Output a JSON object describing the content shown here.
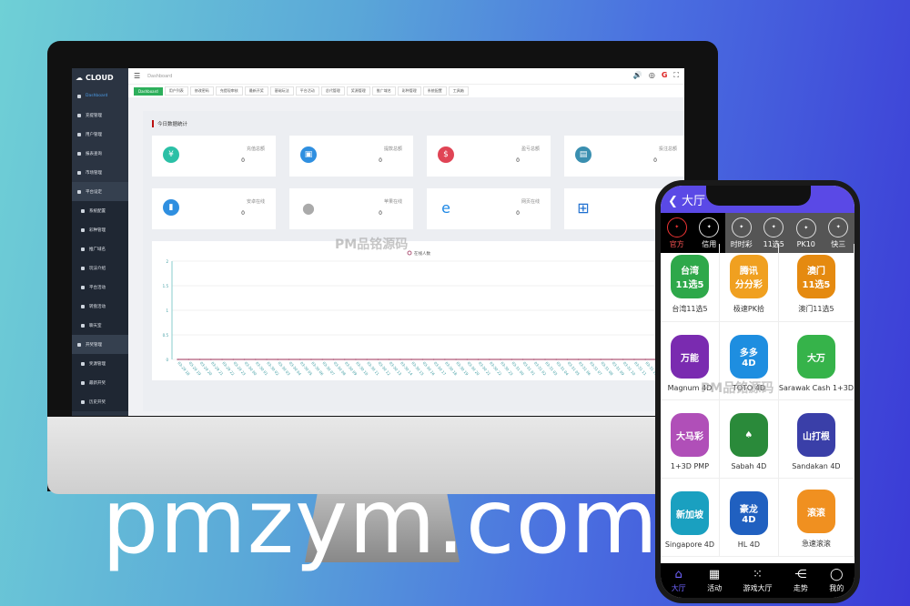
{
  "admin": {
    "logo": "CLOUD",
    "breadcrumb": "Dashboard",
    "sidebar": [
      {
        "label": "Dashboard",
        "active": true
      },
      {
        "label": "充提管理"
      },
      {
        "label": "用户管理"
      },
      {
        "label": "报表查询"
      },
      {
        "label": "市场管理"
      },
      {
        "label": "平台设定",
        "open": true
      },
      {
        "label": "系统配置",
        "sub": true
      },
      {
        "label": "彩种管理",
        "sub": true
      },
      {
        "label": "推广域名",
        "sub": true
      },
      {
        "label": "玩法介绍",
        "sub": true
      },
      {
        "label": "平台活动",
        "sub": true
      },
      {
        "label": "转盘活动",
        "sub": true
      },
      {
        "label": "聊天室",
        "sub": true
      },
      {
        "label": "开奖管理",
        "open": true
      },
      {
        "label": "奖源管理",
        "sub": true
      },
      {
        "label": "最新开奖",
        "sub": true
      },
      {
        "label": "历史开奖",
        "sub": true
      }
    ],
    "tabs": [
      "Dashboard",
      "用户列表",
      "修改密码",
      "充提现审核",
      "最新开奖",
      "基础玩法",
      "平台活动",
      "总代管理",
      "奖源管理",
      "推广域名",
      "彩种管理",
      "系统配置",
      "工具箱"
    ],
    "section_title": "今日数据统计",
    "cards": [
      {
        "label": "充值总额",
        "value": "0",
        "icon": "yen-icon",
        "color": "#2bc0a6"
      },
      {
        "label": "提款总额",
        "value": "0",
        "icon": "wallet-icon",
        "color": "#2f8fe0"
      },
      {
        "label": "盈亏总额",
        "value": "0",
        "icon": "coins-icon",
        "color": "#e04455"
      },
      {
        "label": "投注总额",
        "value": "0",
        "icon": "receipt-icon",
        "color": "#3a8fb0"
      },
      {
        "label": "安卓在线",
        "value": "0",
        "icon": "android-icon",
        "color": "#2f8fe0"
      },
      {
        "label": "苹果在线",
        "value": "0",
        "icon": "apple-icon",
        "color": "#aaaaaa"
      },
      {
        "label": "网页在线",
        "value": "0",
        "icon": "ie-icon",
        "color": "#1e88e5"
      },
      {
        "label": "",
        "value": "",
        "icon": "windows-icon",
        "color": "#1e6fd0"
      }
    ]
  },
  "chart_data": {
    "type": "line",
    "legend": "在线人数",
    "ylim": [
      0,
      2
    ],
    "yticks": [
      "0",
      "0.5",
      "1",
      "1.5",
      "2"
    ],
    "categories": [
      "03-29 18",
      "03-29 19",
      "03-29 20",
      "03-29 21",
      "03-29 22",
      "03-29 23",
      "03-30 00",
      "03-30 01",
      "03-30 02",
      "03-30 03",
      "03-30 04",
      "03-30 05",
      "03-30 06",
      "03-30 07",
      "03-30 08",
      "03-30 09",
      "03-30 10",
      "03-30 11",
      "03-30 12",
      "03-30 13",
      "03-30 14",
      "03-30 15",
      "03-30 16",
      "03-30 17",
      "03-30 18",
      "03-30 19",
      "03-30 20",
      "03-30 21",
      "03-30 22",
      "03-30 23",
      "03-31 00",
      "03-31 01",
      "03-31 02",
      "03-31 03",
      "03-31 04",
      "03-31 05",
      "03-31 06",
      "03-31 07",
      "03-31 08",
      "03-31 09",
      "03-31 10",
      "03-31 11",
      "03-31 12",
      "03-31 13",
      "03-31 14",
      "03-31 15"
    ],
    "values": [
      0,
      0,
      0,
      0,
      0,
      0,
      0,
      0,
      0,
      0,
      0,
      0,
      0,
      0,
      0,
      0,
      0,
      0,
      0,
      0,
      0,
      0,
      0,
      0,
      0,
      0,
      0,
      0,
      0,
      0,
      0,
      0,
      0,
      0,
      0,
      0,
      0,
      0,
      0,
      0,
      0,
      0,
      0,
      0,
      0,
      0
    ],
    "line_color": "#b05a7a"
  },
  "phone": {
    "title": "大厅",
    "tabs": [
      "官方",
      "信用",
      "时时彩",
      "11选5",
      "PK10",
      "快三"
    ],
    "games": [
      {
        "name": "台湾11选5",
        "icon": "台湾\n11选5",
        "color": "#2ea84a"
      },
      {
        "name": "极速PK拾",
        "icon": "腾讯\n分分彩",
        "color": "#f0a020"
      },
      {
        "name": "澳门11选5",
        "icon": "澳门\n11选5",
        "color": "#e58a10"
      },
      {
        "name": "Magnum 4D",
        "icon": "万能",
        "color": "#7a2bb0"
      },
      {
        "name": "TOTO 4D",
        "icon": "多多\n4D",
        "color": "#1e8ee0"
      },
      {
        "name": "Sarawak Cash 1+3D",
        "icon": "大万",
        "color": "#36b34a"
      },
      {
        "name": "1+3D PMP",
        "icon": "大马彩",
        "color": "#b04fb8"
      },
      {
        "name": "Sabah 4D",
        "icon": "♠",
        "color": "#2a8a3a"
      },
      {
        "name": "Sandakan 4D",
        "icon": "山打根",
        "color": "#3a3fa8"
      },
      {
        "name": "Singapore 4D",
        "icon": "新加坡",
        "color": "#1aa0c0"
      },
      {
        "name": "HL 4D",
        "icon": "豪龙\n4D",
        "color": "#2060c0"
      },
      {
        "name": "急速滚滚",
        "icon": "滚滚",
        "color": "#f09020"
      }
    ],
    "nav": [
      "大厅",
      "活动",
      "游戏大厅",
      "走势",
      "我的"
    ]
  },
  "watermark": "PM品铭源码",
  "headline": "pmzym.com"
}
